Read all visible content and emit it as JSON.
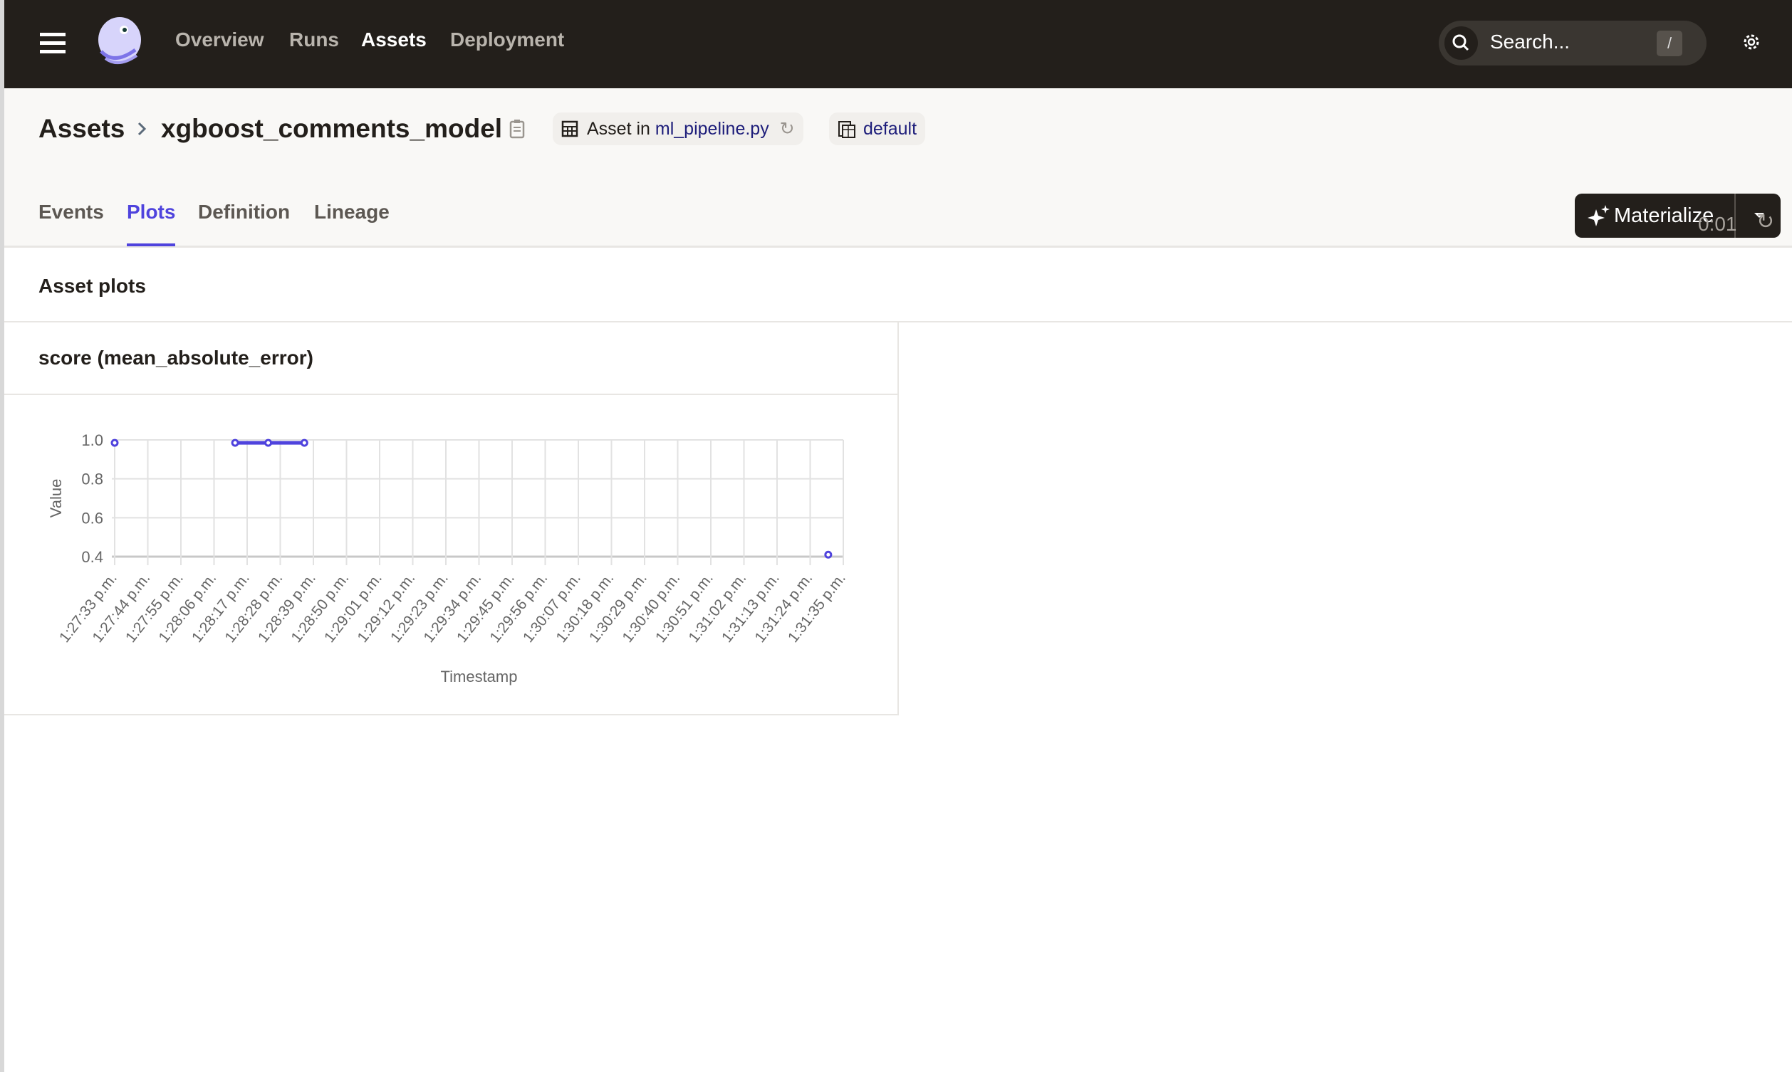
{
  "nav": {
    "items": [
      {
        "label": "Overview",
        "active": false
      },
      {
        "label": "Runs",
        "active": false
      },
      {
        "label": "Assets",
        "active": true
      },
      {
        "label": "Deployment",
        "active": false
      }
    ],
    "search_placeholder": "Search...",
    "search_shortcut": "/"
  },
  "header": {
    "breadcrumb_root": "Assets",
    "asset_name": "xgboost_comments_model",
    "asset_in_label": "Asset in",
    "asset_file": "ml_pipeline.py",
    "code_location": "default",
    "materialize_label": "Materialize"
  },
  "tabs": [
    {
      "label": "Events",
      "active": false
    },
    {
      "label": "Plots",
      "active": true
    },
    {
      "label": "Definition",
      "active": false
    },
    {
      "label": "Lineage",
      "active": false
    }
  ],
  "refresh_timer": "0:01",
  "section_title": "Asset plots",
  "plot_card_title": "score (mean_absolute_error)",
  "accent_color": "#4f43dd",
  "chart_data": {
    "type": "line",
    "xlabel": "Timestamp",
    "ylabel": "Value",
    "ylim": [
      0.4,
      1.0
    ],
    "yticks": [
      "0.4",
      "0.6",
      "0.8",
      "1.0"
    ],
    "xticks": [
      "1:27:33 p.m.",
      "1:27:44 p.m.",
      "1:27:55 p.m.",
      "1:28:06 p.m.",
      "1:28:17 p.m.",
      "1:28:28 p.m.",
      "1:28:39 p.m.",
      "1:28:50 p.m.",
      "1:29:01 p.m.",
      "1:29:12 p.m.",
      "1:29:23 p.m.",
      "1:29:34 p.m.",
      "1:29:45 p.m.",
      "1:29:56 p.m.",
      "1:30:07 p.m.",
      "1:30:18 p.m.",
      "1:30:29 p.m.",
      "1:30:40 p.m.",
      "1:30:51 p.m.",
      "1:31:02 p.m.",
      "1:31:13 p.m.",
      "1:31:24 p.m.",
      "1:31:35 p.m."
    ],
    "grid": true,
    "series": [
      {
        "color": "#4f43dd",
        "segments": [
          [
            {
              "x": "1:27:33 p.m.",
              "y": 0.985
            }
          ],
          [
            {
              "x": "1:28:13 p.m.",
              "y": 0.985
            },
            {
              "x": "1:28:24 p.m.",
              "y": 0.985
            },
            {
              "x": "1:28:36 p.m.",
              "y": 0.985
            }
          ],
          [
            {
              "x": "1:31:30 p.m.",
              "y": 0.41
            }
          ]
        ]
      }
    ]
  }
}
